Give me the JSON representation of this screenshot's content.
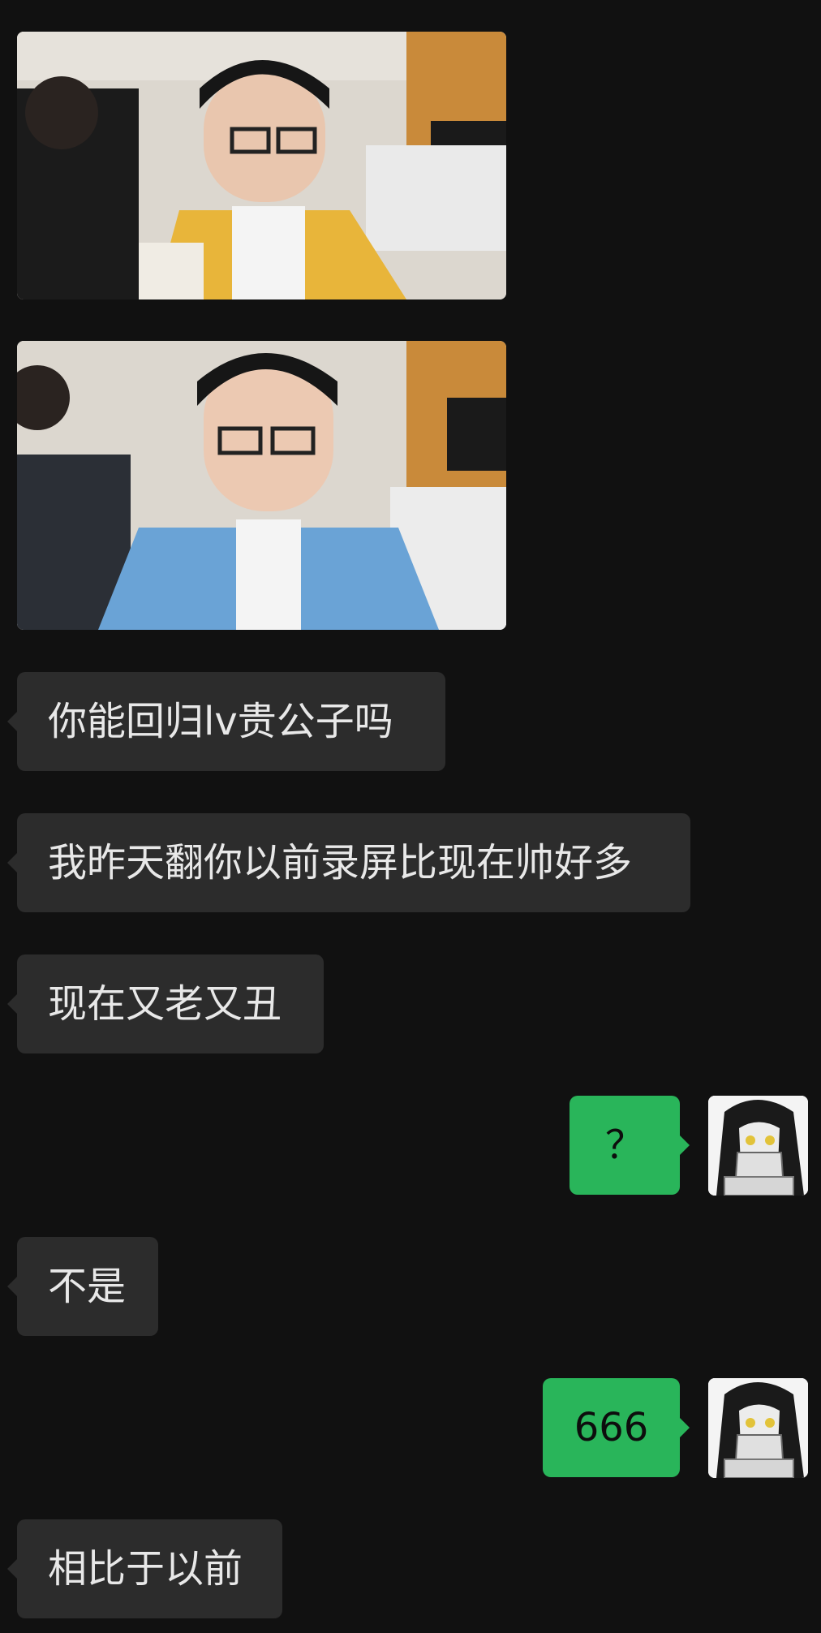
{
  "chat": {
    "messages": [
      {
        "side": "left",
        "type": "image",
        "content": "streamer-screenshot-yellow-jacket"
      },
      {
        "side": "left",
        "type": "image",
        "content": "streamer-screenshot-denim-jacket"
      },
      {
        "side": "left",
        "type": "text",
        "text": "你能回归lv贵公子吗"
      },
      {
        "side": "left",
        "type": "text",
        "text": "我昨天翻你以前录屏比现在帅好多"
      },
      {
        "side": "left",
        "type": "text",
        "text": "现在又老又丑"
      },
      {
        "side": "right",
        "type": "text",
        "text": "？"
      },
      {
        "side": "left",
        "type": "text",
        "text": "不是"
      },
      {
        "side": "right",
        "type": "text",
        "text": "666"
      },
      {
        "side": "left",
        "type": "text",
        "text": "相比于以前"
      }
    ]
  },
  "colors": {
    "background": "#111111",
    "incoming_bubble": "#2c2c2c",
    "outgoing_bubble": "#29b55a"
  },
  "icons": {
    "avatar": "anime-character-avatar"
  }
}
